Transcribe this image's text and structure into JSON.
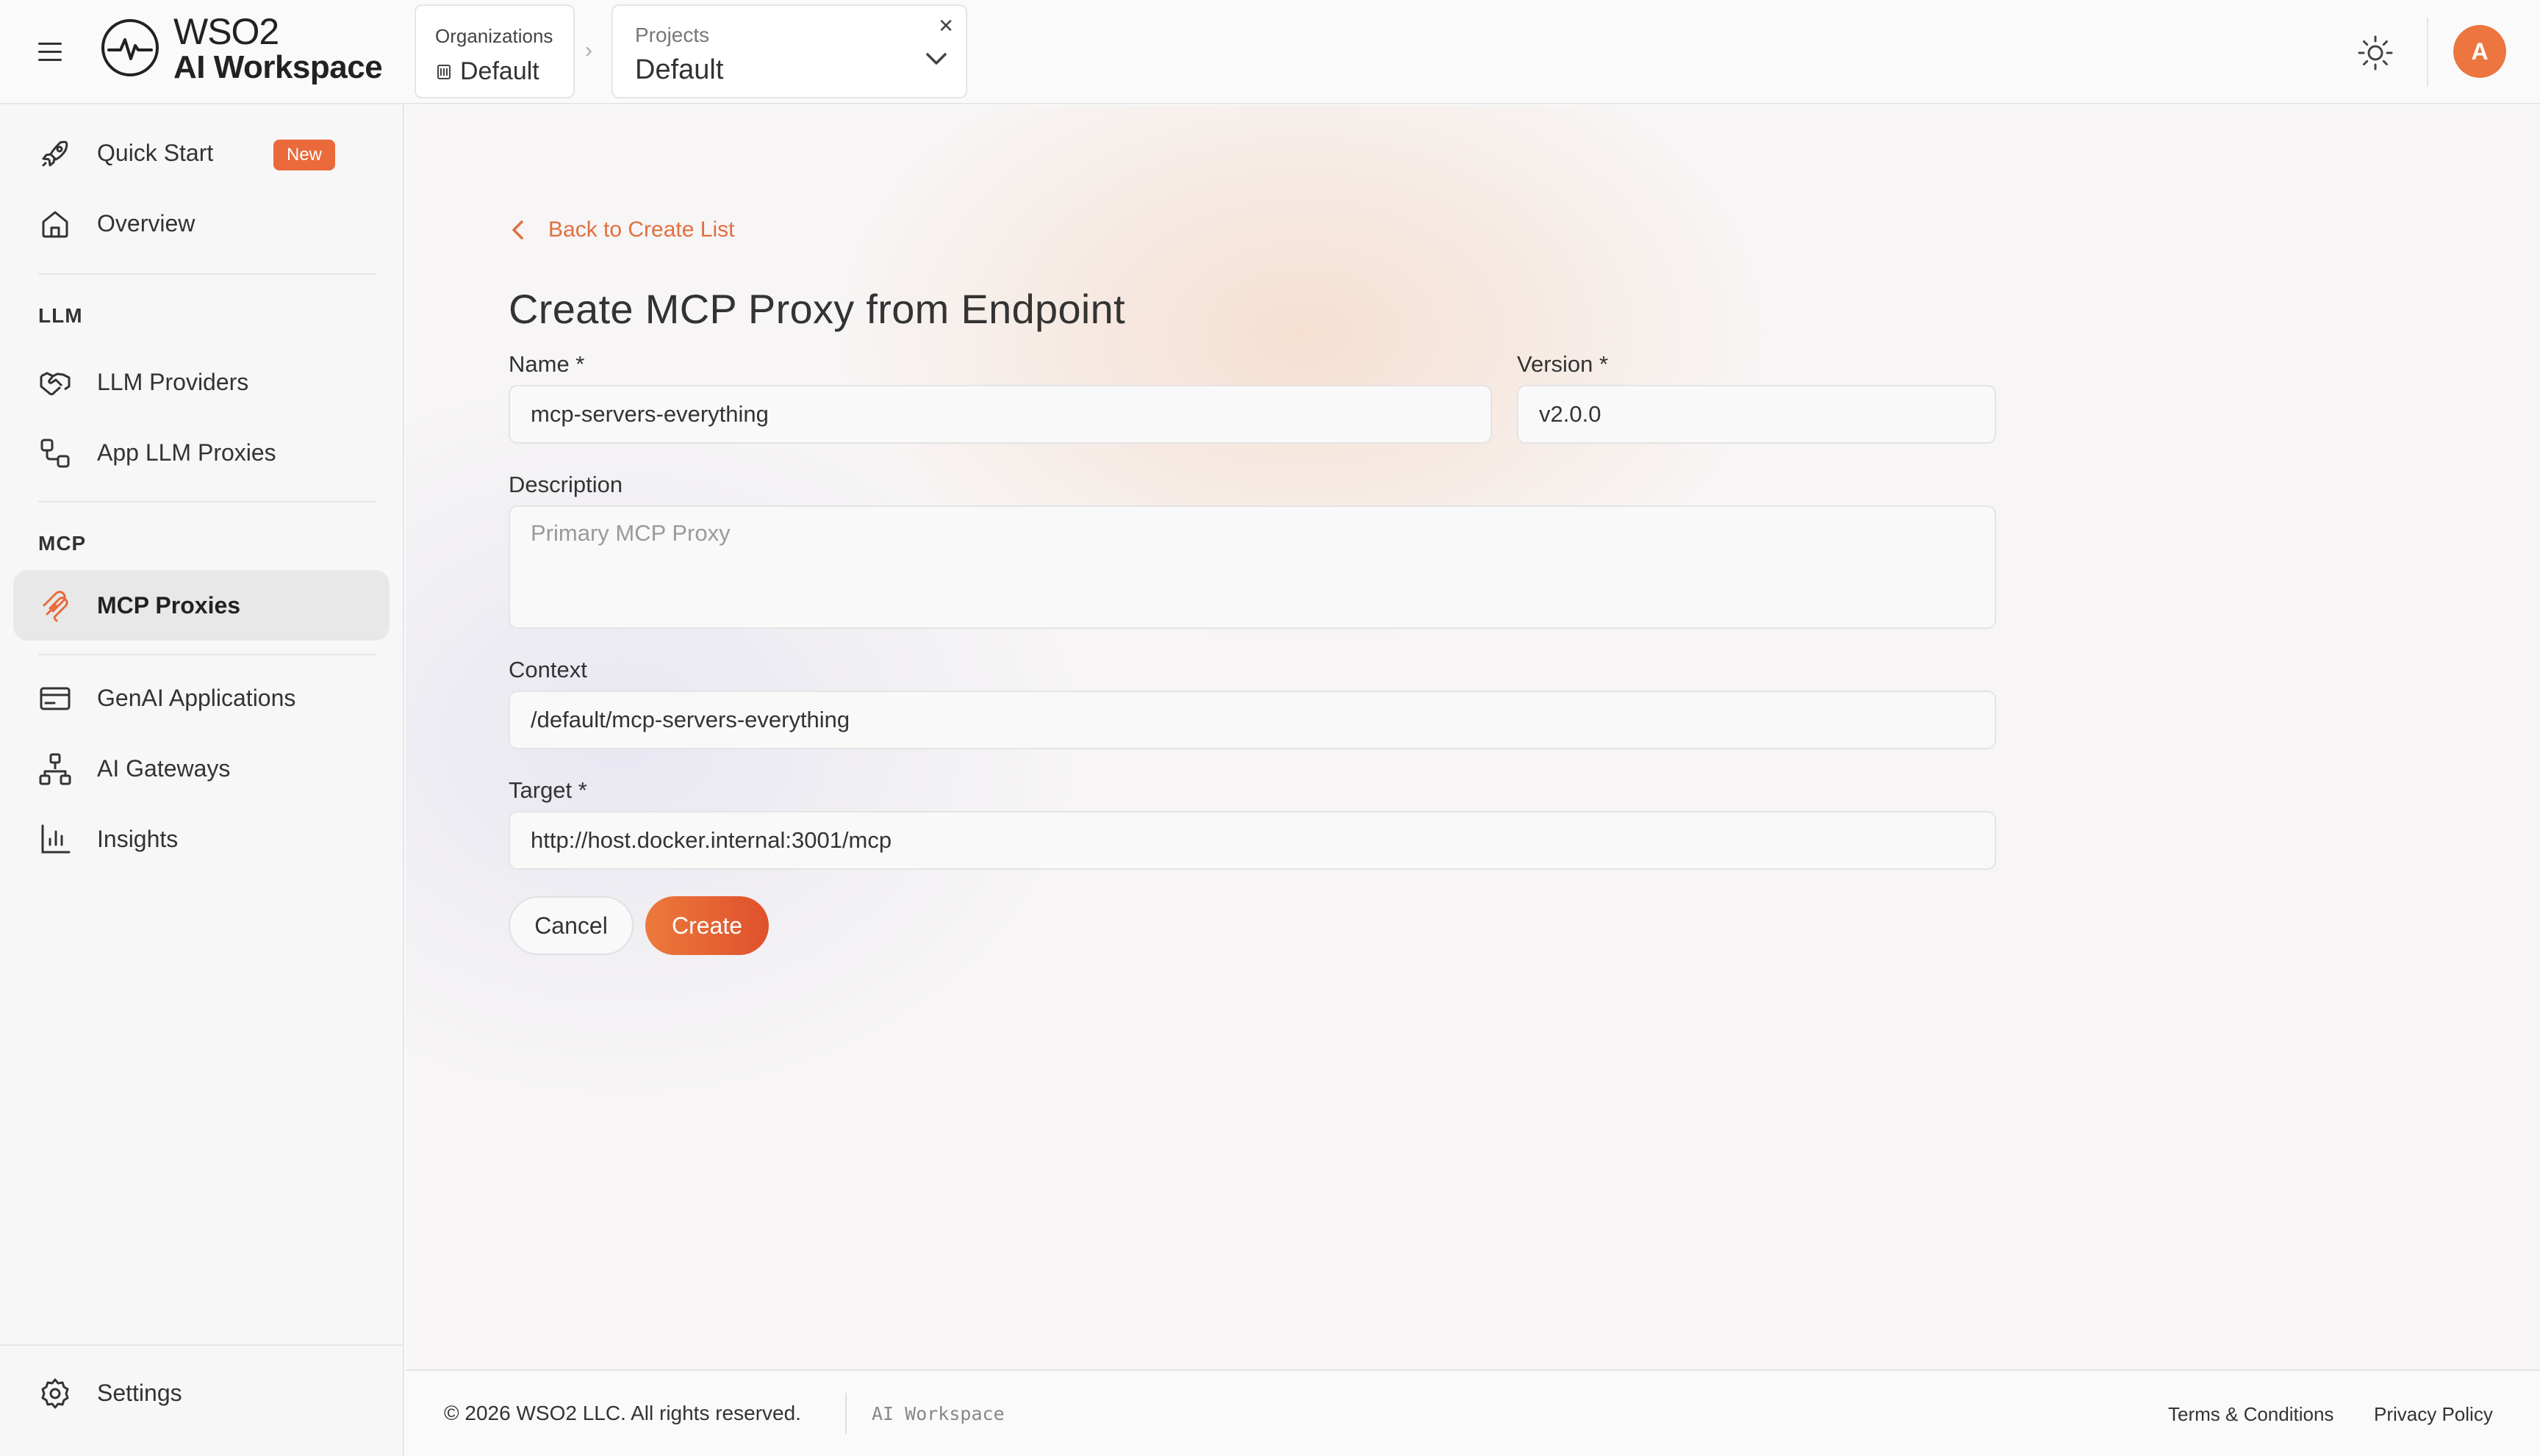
{
  "app": {
    "logo_line1": "WSO2",
    "logo_line2": "AI Workspace"
  },
  "header": {
    "org_label": "Organizations",
    "org_value": "Default",
    "project_label": "Projects",
    "project_value": "Default",
    "avatar_initial": "A"
  },
  "sidebar": {
    "quick_start": "Quick Start",
    "new_badge": "New",
    "overview": "Overview",
    "section_llm": "LLM",
    "llm_providers": "LLM Providers",
    "app_llm_proxies": "App LLM Proxies",
    "section_mcp": "MCP",
    "mcp_proxies": "MCP Proxies",
    "genai_applications": "GenAI Applications",
    "ai_gateways": "AI Gateways",
    "insights": "Insights",
    "settings": "Settings"
  },
  "form": {
    "back_link": "Back to Create List",
    "title": "Create MCP Proxy from Endpoint",
    "name_label": "Name *",
    "name_value": "mcp-servers-everything",
    "version_label": "Version *",
    "version_value": "v2.0.0",
    "description_label": "Description",
    "description_placeholder": "Primary MCP Proxy",
    "context_label": "Context",
    "context_value": "/default/mcp-servers-everything",
    "target_label": "Target *",
    "target_value": "http://host.docker.internal:3001/mcp",
    "cancel_label": "Cancel",
    "create_label": "Create"
  },
  "footer": {
    "copyright": "© 2026 WSO2 LLC. All rights reserved.",
    "product": "AI Workspace",
    "terms": "Terms & Conditions",
    "privacy": "Privacy Policy"
  },
  "colors": {
    "accent": "#ea6a3c",
    "accent_dark": "#e0502c"
  }
}
